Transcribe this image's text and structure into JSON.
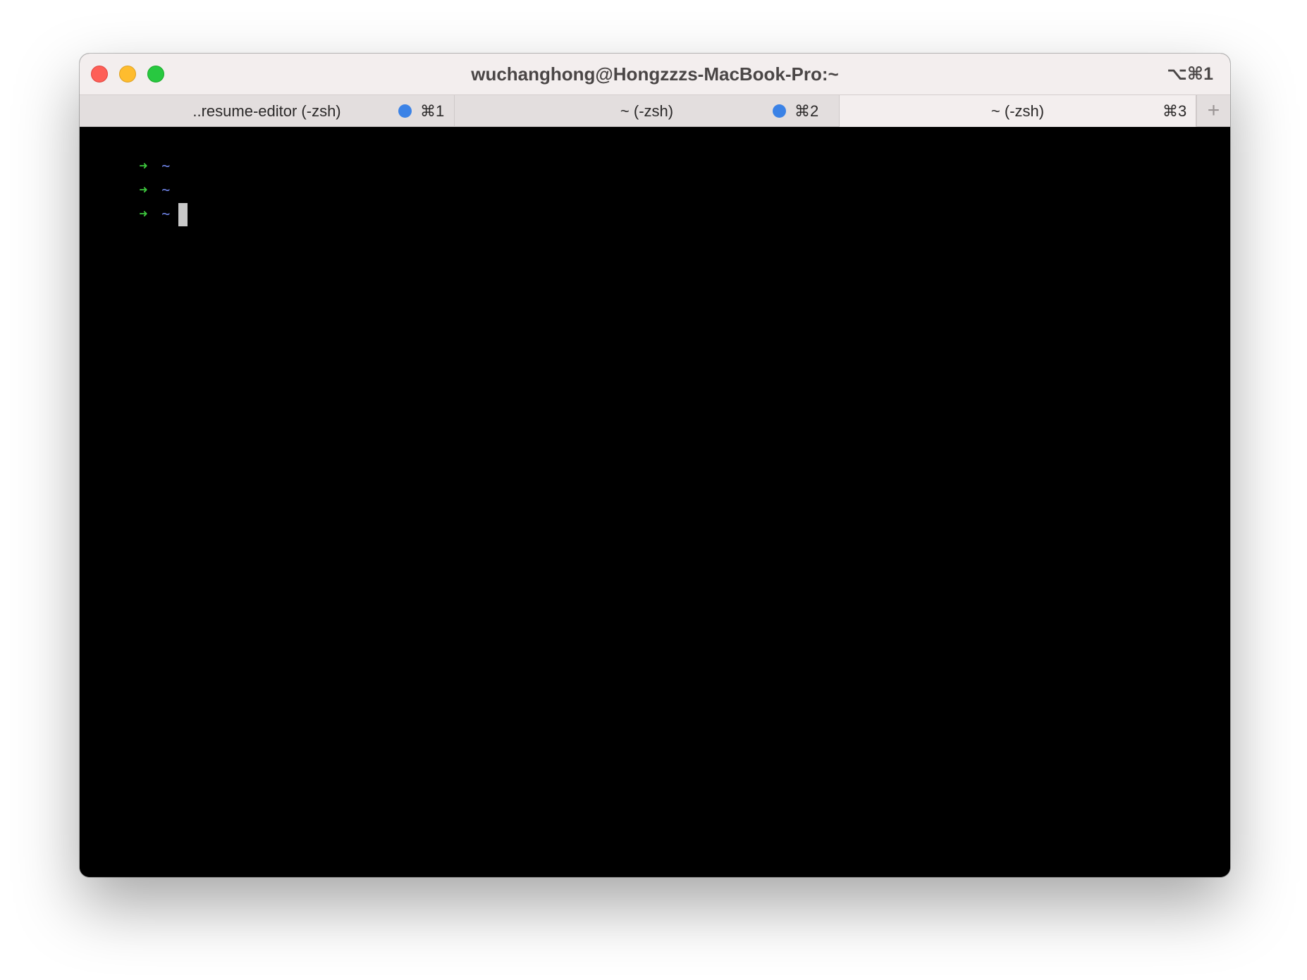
{
  "window": {
    "title": "wuchanghong@Hongzzzs-MacBook-Pro:~",
    "shortcut": "⌥⌘1"
  },
  "tabs": [
    {
      "label": "..resume-editor (-zsh)",
      "shortcut": "⌘1",
      "activity_dot": true,
      "active": false
    },
    {
      "label": "~ (-zsh)",
      "shortcut": "⌘2",
      "activity_dot": true,
      "active": false
    },
    {
      "label": "~ (-zsh)",
      "shortcut": "⌘3",
      "activity_dot": false,
      "active": true
    }
  ],
  "new_tab_icon": "+",
  "terminal": {
    "lines": [
      {
        "prompt_symbol": "➜",
        "cwd": "~"
      },
      {
        "prompt_symbol": "➜",
        "cwd": "~"
      },
      {
        "prompt_symbol": "➜",
        "cwd": "~"
      }
    ]
  },
  "colors": {
    "titlebar": "#f3eeee",
    "tabbar": "#e3dede",
    "terminal_bg": "#000000",
    "prompt_arrow": "#3ec93e",
    "prompt_cwd": "#6f84e8",
    "activity_dot": "#3b82e6",
    "close": "#fe5f57",
    "minimize": "#febc2e",
    "maximize": "#28c840"
  }
}
